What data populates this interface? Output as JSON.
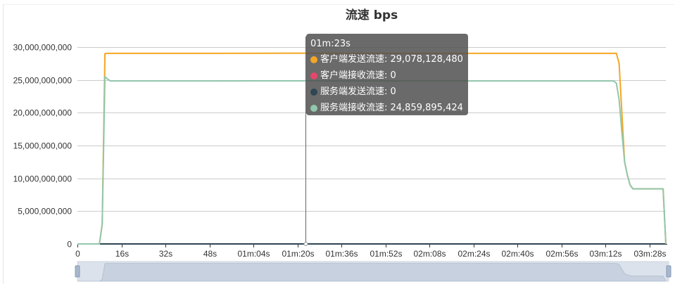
{
  "chart_data": {
    "type": "line",
    "title": "流速 bps",
    "xlabel": "",
    "ylabel": "",
    "x_tick_labels": [
      "0",
      "16s",
      "32s",
      "48s",
      "01m:04s",
      "01m:20s",
      "01m:36s",
      "01m:52s",
      "02m:08s",
      "02m:24s",
      "02m:40s",
      "02m:56s",
      "03m:12s",
      "03m:28s"
    ],
    "x_tick_seconds": [
      0,
      16,
      32,
      48,
      64,
      80,
      96,
      112,
      128,
      144,
      160,
      176,
      192,
      208
    ],
    "xlim_seconds": [
      0,
      214
    ],
    "ylim": [
      0,
      30000000000
    ],
    "y_tick_labels": [
      "0",
      "5,000,000,000",
      "10,000,000,000",
      "15,000,000,000",
      "20,000,000,000",
      "25,000,000,000",
      "30,000,000,000"
    ],
    "y_tick_values": [
      0,
      5000000000,
      10000000000,
      15000000000,
      20000000000,
      25000000000,
      30000000000
    ],
    "grid": true,
    "legend": "none",
    "series": [
      {
        "name": "客户端发送流速",
        "color": "#f5a623",
        "x_seconds": [
          0,
          8,
          9,
          10,
          11,
          20,
          50,
          80,
          110,
          140,
          170,
          196,
          197,
          198,
          199,
          200,
          201,
          202,
          204,
          213,
          214
        ],
        "values": [
          0,
          0,
          3000000000,
          29000000000,
          29050000000,
          29050000000,
          29050000000,
          29078128480,
          29050000000,
          29050000000,
          29050000000,
          29050000000,
          27500000000,
          20000000000,
          12500000000,
          10500000000,
          9000000000,
          8400000000,
          8400000000,
          8400000000,
          0
        ]
      },
      {
        "name": "客户端接收流速",
        "color": "#e8456b",
        "x_seconds": [
          0,
          214
        ],
        "values": [
          0,
          0
        ]
      },
      {
        "name": "服务端发送流速",
        "color": "#2f4554",
        "x_seconds": [
          0,
          214
        ],
        "values": [
          0,
          0
        ]
      },
      {
        "name": "服务端接收流速",
        "color": "#91c7ae",
        "x_seconds": [
          0,
          8,
          9,
          10,
          11,
          12,
          20,
          50,
          80,
          110,
          140,
          170,
          195,
          196,
          197,
          198,
          199,
          200,
          201,
          202,
          204,
          213,
          214
        ],
        "values": [
          0,
          0,
          3000000000,
          25500000000,
          25100000000,
          24850000000,
          24850000000,
          24850000000,
          24859895424,
          24850000000,
          24850000000,
          24850000000,
          24850000000,
          24500000000,
          22000000000,
          17000000000,
          12500000000,
          10500000000,
          9000000000,
          8400000000,
          8400000000,
          8400000000,
          0
        ]
      }
    ],
    "tooltip": {
      "title": "01m:23s",
      "x_seconds": 83,
      "rows": [
        {
          "label": "客户端发送流速: 29,078,128,480",
          "color": "#f5a623"
        },
        {
          "label": "客户端接收流速: 0",
          "color": "#e8456b"
        },
        {
          "label": "服务端发送流速: 0",
          "color": "#2f4554"
        },
        {
          "label": "服务端接收流速: 24,859,895,424",
          "color": "#91c7ae"
        }
      ]
    },
    "data_zoom": {
      "range_seconds": [
        0,
        214
      ]
    }
  }
}
